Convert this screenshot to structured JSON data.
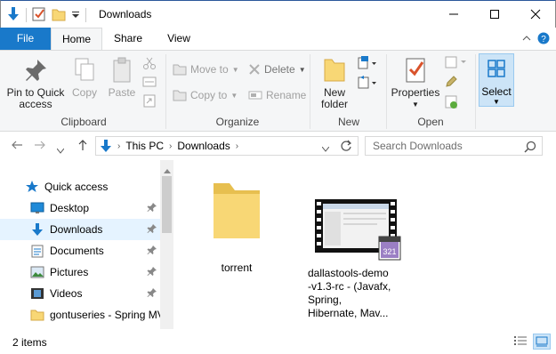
{
  "window": {
    "title": "Downloads",
    "minimize_icon": "minimize-icon",
    "maximize_icon": "maximize-icon",
    "close_icon": "close-icon"
  },
  "ribbon_tabs": {
    "file": "File",
    "home": "Home",
    "share": "Share",
    "view": "View"
  },
  "ribbon": {
    "clipboard": {
      "pin_line1": "Pin to Quick",
      "pin_line2": "access",
      "copy": "Copy",
      "paste": "Paste",
      "label": "Clipboard"
    },
    "organize": {
      "move_to": "Move to",
      "copy_to": "Copy to",
      "delete": "Delete",
      "rename": "Rename",
      "label": "Organize"
    },
    "new": {
      "new_line1": "New",
      "new_line2": "folder",
      "label": "New"
    },
    "open": {
      "properties": "Properties",
      "label": "Open"
    },
    "select": {
      "label": "Select"
    }
  },
  "address": {
    "crumbs": [
      "This PC",
      "Downloads"
    ],
    "search_placeholder": "Search Downloads"
  },
  "nav": {
    "items": [
      {
        "label": "Quick access",
        "icon": "star-icon"
      },
      {
        "label": "Desktop",
        "icon": "desktop-icon",
        "pinned": true
      },
      {
        "label": "Downloads",
        "icon": "download-icon",
        "pinned": true,
        "selected": true
      },
      {
        "label": "Documents",
        "icon": "document-icon",
        "pinned": true
      },
      {
        "label": "Pictures",
        "icon": "picture-icon",
        "pinned": true
      },
      {
        "label": "Videos",
        "icon": "video-icon",
        "pinned": true
      },
      {
        "label": "gontuseries - Spring MV",
        "icon": "folder-icon"
      }
    ]
  },
  "files": [
    {
      "name": "torrent",
      "type": "folder"
    },
    {
      "name_lines": [
        "dallastools-demo",
        "-v1.3-rc - (Javafx,",
        "Spring,",
        "Hibernate, Mav..."
      ],
      "type": "video"
    }
  ],
  "status": {
    "count": "2 items"
  },
  "colors": {
    "accent": "#1979ca",
    "folder": "#f8d775",
    "selected_bg": "#e5f3ff"
  }
}
